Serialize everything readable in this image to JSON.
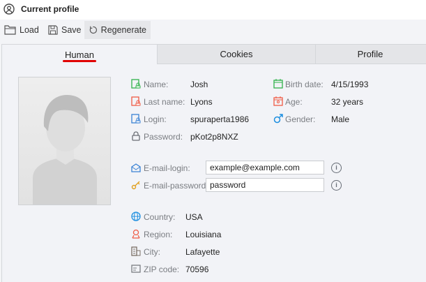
{
  "header": {
    "title": "Current profile",
    "icon": "user-circle-icon"
  },
  "toolbar": {
    "load": "Load",
    "save": "Save",
    "regenerate": "Regenerate"
  },
  "tabs": [
    {
      "label": "Human",
      "active": true
    },
    {
      "label": "Cookies"
    },
    {
      "label": "Profile"
    }
  ],
  "accent": "#e00000",
  "person": {
    "name_label": "Name:",
    "name": "Josh",
    "last_name_label": "Last name:",
    "last_name": "Lyons",
    "login_label": "Login:",
    "login": "spuraperta1986",
    "password_label": "Password:",
    "password": "pKot2p8NXZ",
    "birth_label": "Birth date:",
    "birth": "4/15/1993",
    "age_label": "Age:",
    "age": "32 years",
    "gender_label": "Gender:",
    "gender": "Male"
  },
  "email": {
    "login_label": "E-mail-login:",
    "login": "example@example.com",
    "password_label": "E-mail-password:",
    "password": "password"
  },
  "location": {
    "country_label": "Country:",
    "country": "USA",
    "region_label": "Region:",
    "region": "Louisiana",
    "city_label": "City:",
    "city": "Lafayette",
    "zip_label": "ZIP code:",
    "zip": "70596"
  }
}
